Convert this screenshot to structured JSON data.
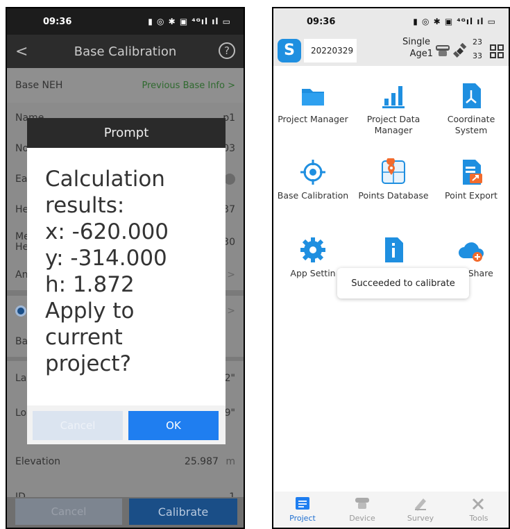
{
  "left": {
    "status_time": "09:36",
    "status_icons": "▮ ◎ ✱ ▣ ⁴ᴳıl ıl ▭",
    "title": "Base Calibration",
    "back_glyph": "<",
    "help_glyph": "?",
    "rows": {
      "base_neh": "Base NEH",
      "prev_base_info": "Previous Base Info >",
      "name_label": "Name",
      "name_value": "p1",
      "north_label": "No",
      "north_value": "03",
      "east_label": "Ea",
      "height_label": "He",
      "height_value": "37",
      "measure_label": "Me\nHe",
      "measure_value": "30",
      "antenna_label": "An",
      "base_label": "Ba",
      "lat_label": "La",
      "lat_value": "2\"",
      "lon_label": "Lo",
      "lon_value": "9\"",
      "elevation_label": "Elevation",
      "elevation_value": "25.987",
      "elevation_unit": "m",
      "id_label": "ID",
      "id_value": "1"
    },
    "bottom_cancel": "Cancel",
    "bottom_calibrate": "Calibrate",
    "dialog": {
      "title": "Prompt",
      "message": "Calculation\nresults:\nx: -620.000\ny: -314.000\nh: 1.872\n Apply to\ncurrent\nproject?",
      "cancel": "Cancel",
      "ok": "OK"
    }
  },
  "right": {
    "status_time": "09:36",
    "status_icons": "▮ ◎ ✱ ▣ ⁴ᴳıl ıl ▭",
    "project_name": "20220329",
    "fix_status": "Single",
    "age": "Age1",
    "sat_a": "23",
    "sat_b": "33",
    "tiles": [
      {
        "label": "Project Manager",
        "icon": "folder-icon"
      },
      {
        "label": "Project Data\nManager",
        "icon": "bar-chart-icon"
      },
      {
        "label": "Coordinate\nSystem",
        "icon": "coordinate-icon"
      },
      {
        "label": "Base Calibration",
        "icon": "crosshair-icon"
      },
      {
        "label": "Points Database",
        "icon": "map-pin-icon"
      },
      {
        "label": "Point Export",
        "icon": "export-icon"
      },
      {
        "label": "App Settin",
        "icon": "gear-icon"
      },
      {
        "label": "",
        "icon": "info-icon"
      },
      {
        "label": "oud Share",
        "icon": "cloud-share-icon"
      }
    ],
    "toast": "Succeeded to calibrate",
    "nav": [
      {
        "label": "Project",
        "icon": "project-icon"
      },
      {
        "label": "Device",
        "icon": "device-icon"
      },
      {
        "label": "Survey",
        "icon": "survey-icon"
      },
      {
        "label": "Tools",
        "icon": "tools-icon"
      }
    ],
    "colors": {
      "accent": "#1f7ef0",
      "brand": "#1f8fe0",
      "orange": "#f26b2d"
    }
  }
}
